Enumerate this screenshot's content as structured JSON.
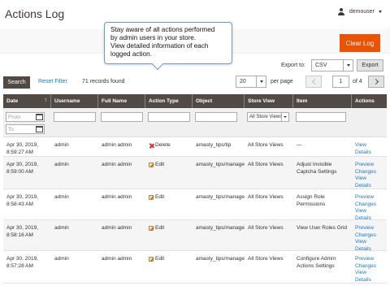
{
  "page": {
    "title": "Actions Log"
  },
  "user_menu": {
    "username": "demouser"
  },
  "tooltip": {
    "lines": [
      "Stay aware of all actions performed",
      "by admin users in your store.",
      "View detailed information of each",
      "logged action."
    ]
  },
  "toolbar": {
    "clear_label": "Clear Log",
    "export_label": "Export to:",
    "export_value": "CSV",
    "export_button": "Export",
    "search_label": "Search",
    "reset_label": "Reset Filter",
    "records_text": "71 records found",
    "per_page_value": "20",
    "per_page_label": "per page",
    "page_current": "1",
    "page_of": "of 4"
  },
  "grid": {
    "columns": [
      "Date",
      "Username",
      "Full Name",
      "Action Type",
      "Object",
      "Store View",
      "Item",
      "Actions"
    ],
    "sort_indicator": "↑",
    "filters": {
      "date_from_placeholder": "From",
      "date_to_placeholder": "To",
      "store_view_value": "All Store Views"
    },
    "rows": [
      {
        "date": "Apr 30, 2019,",
        "time": "8:59:27 AM",
        "username": "admin",
        "full_name": "admin admin",
        "action_type": "Delete",
        "action_icon": "delete-icon",
        "object": "amasty_tips/tip",
        "store_view": "All Store Views",
        "item": "—",
        "actions": [
          "View",
          "Details"
        ]
      },
      {
        "date": "Apr 30, 2019,",
        "time": "8:59:00 AM",
        "username": "admin",
        "full_name": "admin admin",
        "action_type": "Edit",
        "action_icon": "edit-icon",
        "object": "amasty_tips/manage",
        "store_view": "All Store Views",
        "item": "Adjust Invisible Captcha Settings",
        "actions": [
          "Preview",
          "Changes",
          "View",
          "Details"
        ]
      },
      {
        "date": "Apr 30, 2019,",
        "time": "8:58:43 AM",
        "username": "admin",
        "full_name": "admin admin",
        "action_type": "Edit",
        "action_icon": "edit-icon",
        "object": "amasty_tips/manage",
        "store_view": "All Store Views",
        "item": "Assign Role Permissions",
        "actions": [
          "Preview",
          "Changes",
          "View",
          "Details"
        ]
      },
      {
        "date": "Apr 30, 2019,",
        "time": "8:58:16 AM",
        "username": "admin",
        "full_name": "admin admin",
        "action_type": "Edit",
        "action_icon": "edit-icon",
        "object": "amasty_tips/manage",
        "store_view": "All Store Views",
        "item": "View User Roles Grid",
        "actions": [
          "Preview",
          "Changes",
          "View",
          "Details"
        ]
      },
      {
        "date": "Apr 30, 2019,",
        "time": "8:57:28 AM",
        "username": "admin",
        "full_name": "admin admin",
        "action_type": "Edit",
        "action_icon": "edit-icon",
        "object": "amasty_tips/manage",
        "store_view": "All Store Views",
        "item": "Configure Admin Actions Settings",
        "actions": [
          "Preview",
          "Changes",
          "View",
          "Details"
        ]
      }
    ]
  },
  "colors": {
    "accent": "#eb5202",
    "header_bg": "#514943",
    "link": "#1979c3",
    "tooltip_border": "#6a9ad6"
  }
}
